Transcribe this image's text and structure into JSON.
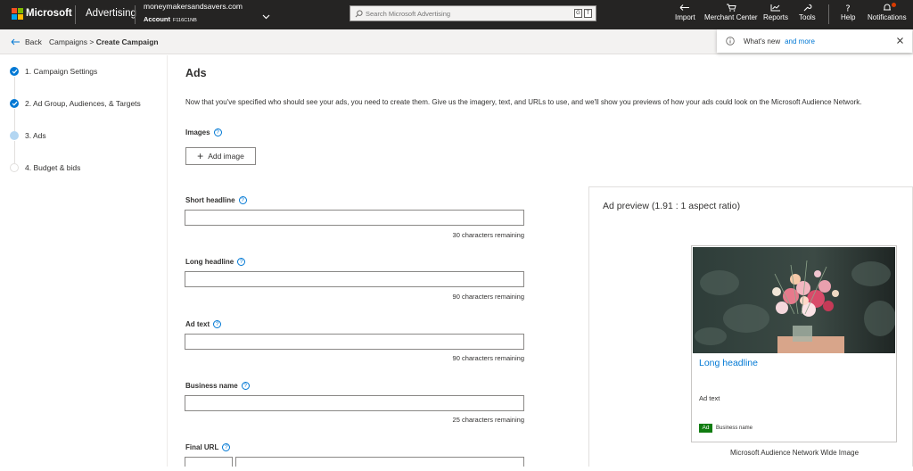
{
  "brand": {
    "logo_colors": [
      "#f25022",
      "#7fba00",
      "#00a4ef",
      "#ffb900"
    ],
    "company": "Microsoft",
    "product": "Advertising"
  },
  "account": {
    "email": "moneymakersandsavers.com",
    "label": "Account",
    "id": "F116C1NB"
  },
  "search": {
    "placeholder": "Search Microsoft Advertising",
    "shortcut_keys": [
      "G",
      "T"
    ]
  },
  "topnav": [
    {
      "label": "Import",
      "icon": "import-icon"
    },
    {
      "label": "Merchant Center",
      "icon": "cart-icon"
    },
    {
      "label": "Reports",
      "icon": "chart-icon"
    },
    {
      "label": "Tools",
      "icon": "wrench-icon"
    },
    {
      "label": "Help",
      "icon": "question-icon"
    },
    {
      "label": "Notifications",
      "icon": "bell-icon"
    }
  ],
  "breadcrumb": {
    "back": "Back",
    "parent": "Campaigns",
    "separator": ">",
    "current": "Create Campaign"
  },
  "whats_new": {
    "text": "What's new",
    "link": "and more"
  },
  "steps": [
    {
      "label": "1. Campaign Settings",
      "state": "done"
    },
    {
      "label": "2. Ad Group, Audiences, & Targets",
      "state": "done"
    },
    {
      "label": "3. Ads",
      "state": "current"
    },
    {
      "label": "4. Budget & bids",
      "state": "todo"
    }
  ],
  "main": {
    "title": "Ads",
    "intro": "Now that you've specified who should see your ads, you need to create them. Give us the imagery, text, and URLs to use, and we'll show you previews of how your ads could look on the Microsoft Audience Network.",
    "images_label": "Images",
    "add_image": "Add image",
    "fields": [
      {
        "label": "Short headline",
        "value": "",
        "remaining": "30 characters remaining"
      },
      {
        "label": "Long headline",
        "value": "",
        "remaining": "90 characters remaining"
      },
      {
        "label": "Ad text",
        "value": "",
        "remaining": "90 characters remaining"
      },
      {
        "label": "Business name",
        "value": "",
        "remaining": "25 characters remaining"
      }
    ],
    "final_url_label": "Final URL"
  },
  "preview": {
    "title": "Ad preview (1.91 : 1 aspect ratio)",
    "headline": "Long headline",
    "ad_text": "Ad text",
    "badge": "Ad",
    "business": "Business name",
    "caption": "Microsoft Audience Network Wide Image"
  },
  "colors": {
    "accent": "#0078d4",
    "topbar": "#252423",
    "ad_badge": "#107c10"
  }
}
